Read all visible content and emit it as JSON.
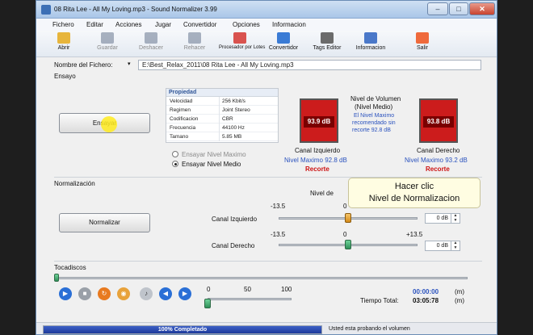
{
  "window": {
    "title": "08 Rita Lee - All My Loving.mp3 - Sound Normalizer 3.99"
  },
  "caption_buttons": {
    "minimize": "–",
    "maximize": "□",
    "close": "✕"
  },
  "menu": [
    "Fichero",
    "Editar",
    "Acciones",
    "Jugar",
    "Convertidor",
    "Opciones",
    "Informacion"
  ],
  "toolbar": [
    {
      "label": "Abrir",
      "icon": "folder-open-icon",
      "enabled": true,
      "color": "#e7b53c"
    },
    {
      "label": "Guardar",
      "icon": "save-disk-icon",
      "enabled": false,
      "color": "#4a5a78"
    },
    {
      "label": "Deshacer",
      "icon": "undo-icon",
      "enabled": false,
      "color": "#4a5a78"
    },
    {
      "label": "Rehacer",
      "icon": "redo-icon",
      "enabled": false,
      "color": "#4a5a78"
    },
    {
      "label": "Procesador por Lotes",
      "icon": "batch-processor-icon",
      "enabled": true,
      "color": "#d9534f"
    },
    {
      "label": "Convertidor",
      "icon": "converter-icon",
      "enabled": true,
      "color": "#3a7bd5"
    },
    {
      "label": "Tags Editor",
      "icon": "tag-icon",
      "enabled": true,
      "color": "#6b6b6b"
    },
    {
      "label": "Informacion",
      "icon": "info-icon",
      "enabled": true,
      "color": "#4a78c9"
    },
    {
      "label": "Salir",
      "icon": "exit-icon",
      "enabled": true,
      "color": "#ef6a3c"
    }
  ],
  "file": {
    "label": "Nombre del Fichero:",
    "path": "E:\\Best_Relax_2011\\08 Rita Lee - All My Loving.mp3"
  },
  "test": {
    "section_label": "Ensayo",
    "button": "Ensayar",
    "properties_header": "Propiedad",
    "properties": [
      {
        "k": "Velocidad",
        "v": "256 Kbit/s"
      },
      {
        "k": "Regimen",
        "v": "Joint Stereo"
      },
      {
        "k": "Codificacion",
        "v": "CBR"
      },
      {
        "k": "Frecuencia",
        "v": "44100 Hz"
      },
      {
        "k": "Tamano",
        "v": "5.85 MB"
      }
    ],
    "radio_max": "Ensayar Nivel Maximo",
    "radio_avg": "Ensayar Nivel Medio",
    "volume_title_1": "Nivel de Volumen",
    "volume_title_2": "(Nivel Medio)",
    "recommend_1": "El Nivel Maximo",
    "recommend_2": "recomendado sin",
    "recommend_3": "recorte 92.8 dB",
    "left": {
      "value": "93.9 dB",
      "label": "Canal Izquierdo",
      "max": "Nivel Maximo 92.8 dB",
      "clip": "Recorte"
    },
    "right": {
      "value": "93.8 dB",
      "label": "Canal Derecho",
      "max": "Nivel Maximo 93.2 dB",
      "clip": "Recorte"
    }
  },
  "normalization": {
    "section_label": "Normalización",
    "button": "Normalizar",
    "level_label": "Nivel de",
    "left_label": "Canal Izquierdo",
    "right_label": "Canal Derecho",
    "min": "-13.5",
    "mid": "0",
    "max": "+13.5",
    "left_db": "0 dB",
    "right_db": "0 dB",
    "left_level": 0,
    "right_level": 0
  },
  "tooltip": {
    "line1": "Hacer clic",
    "line2": "Nivel de Normalizacion"
  },
  "player": {
    "section_label": "Tocadiscos",
    "position_fraction": 0.0,
    "volume_ticks": [
      "0",
      "50",
      "100"
    ],
    "volume_level": 0,
    "time_current": "00:00:00",
    "time_current_unit": "(m)",
    "total_label": "Tiempo Total:",
    "time_total": "03:05:78",
    "time_total_unit": "(m)"
  },
  "status": {
    "progress_text": "100% Completado",
    "progress_value": 1.0,
    "message": "Usted esta probando el volumen"
  }
}
